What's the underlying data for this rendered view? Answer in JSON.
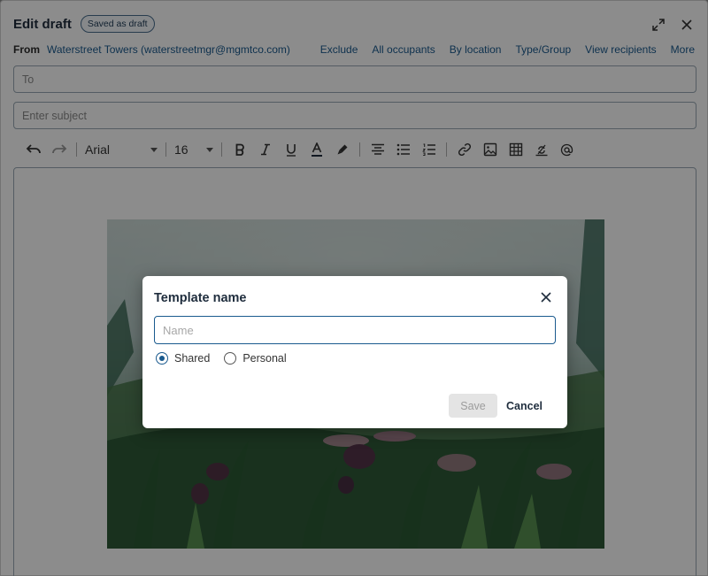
{
  "header": {
    "title": "Edit draft",
    "badge": "Saved as draft"
  },
  "from": {
    "label": "From",
    "value": "Waterstreet Towers (waterstreetmgr@mgmtco.com)",
    "links": [
      "Exclude",
      "All occupants",
      "By location",
      "Type/Group",
      "View recipients",
      "More"
    ]
  },
  "fields": {
    "to_placeholder": "To",
    "subject_placeholder": "Enter subject"
  },
  "toolbar": {
    "font": "Arial",
    "size": "16",
    "icons": [
      "undo-icon",
      "redo-icon",
      "bold-icon",
      "italic-icon",
      "underline-icon",
      "font-color-icon",
      "highlight-icon",
      "align-center-icon",
      "bullet-list-icon",
      "numbered-list-icon",
      "link-icon",
      "image-icon",
      "table-icon",
      "clear-format-icon",
      "mention-icon"
    ]
  },
  "dialog": {
    "title": "Template name",
    "name_placeholder": "Name",
    "options": [
      {
        "label": "Shared",
        "checked": true
      },
      {
        "label": "Personal",
        "checked": false
      }
    ],
    "save_label": "Save",
    "cancel_label": "Cancel"
  },
  "colors": {
    "accent": "#1a5a8e",
    "overlay": "rgba(0,0,0,0.45)"
  }
}
